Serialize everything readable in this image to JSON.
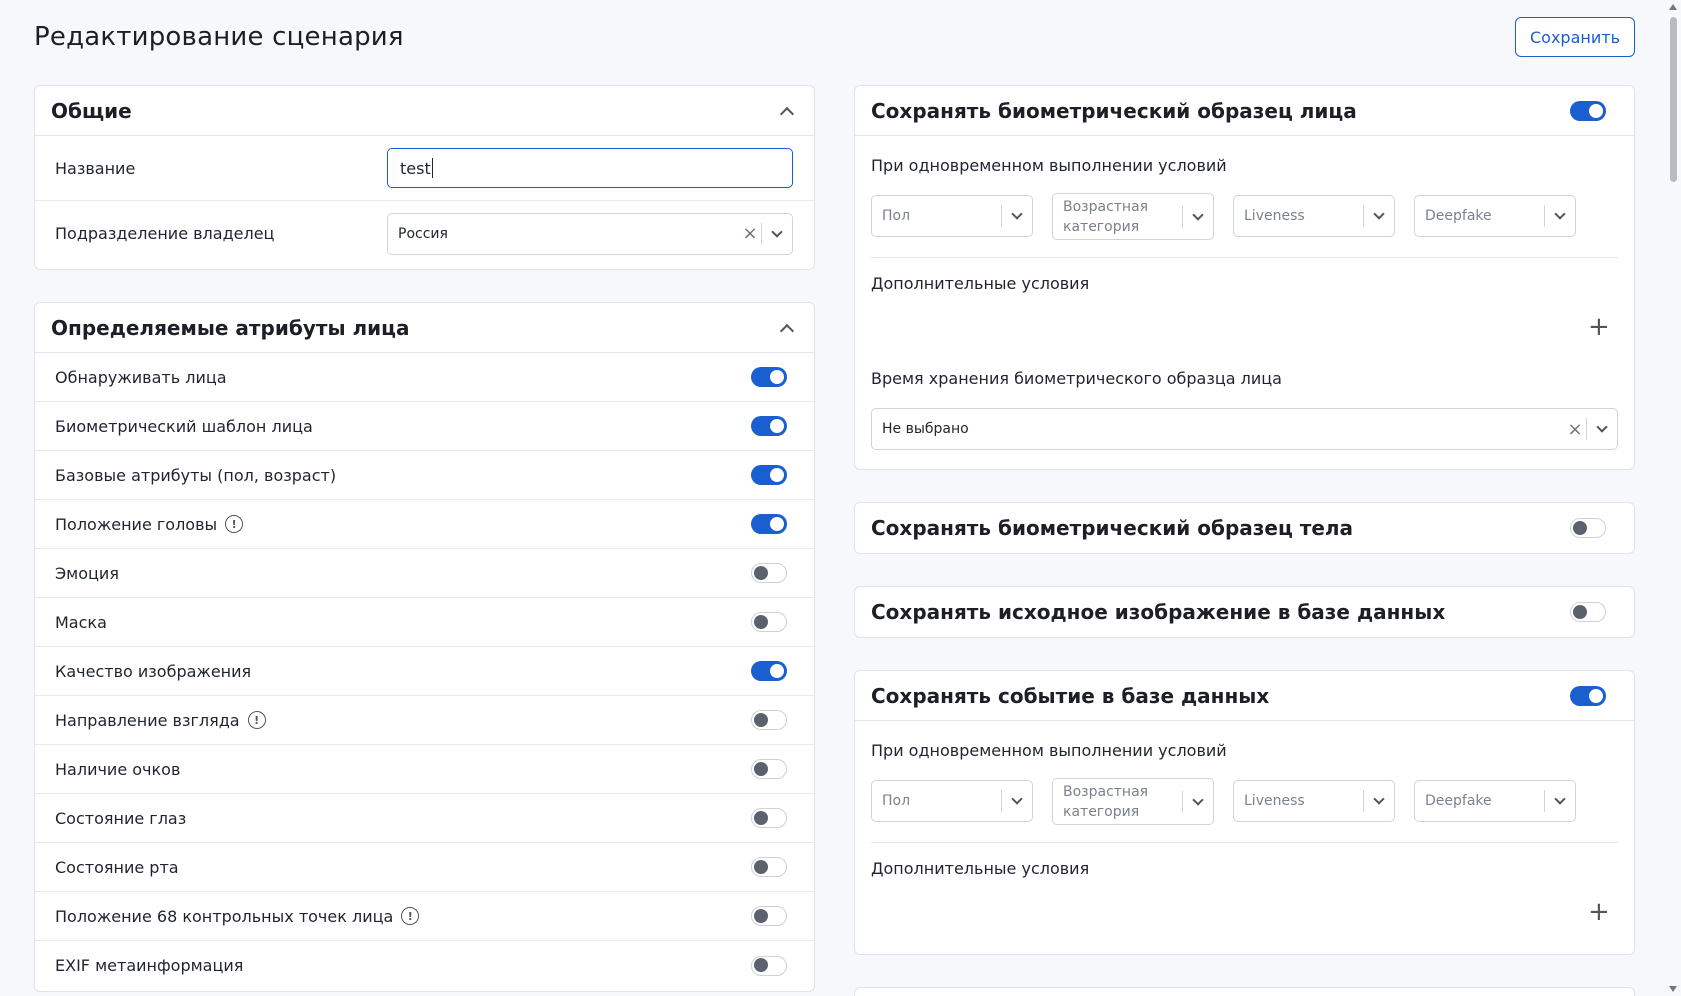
{
  "page": {
    "title": "Редактирование сценария",
    "save_label": "Сохранить"
  },
  "general": {
    "title": "Общие",
    "name_label": "Название",
    "name_value": "test",
    "owner_label": "Подразделение владелец",
    "owner_value": "Россия"
  },
  "attributes": {
    "title": "Определяемые атрибуты лица",
    "items": [
      {
        "label": "Обнаруживать лица",
        "on": true,
        "info": false
      },
      {
        "label": "Биометрический шаблон лица",
        "on": true,
        "info": false
      },
      {
        "label": "Базовые атрибуты (пол, возраст)",
        "on": true,
        "info": false
      },
      {
        "label": "Положение головы",
        "on": true,
        "info": true
      },
      {
        "label": "Эмоция",
        "on": false,
        "info": false
      },
      {
        "label": "Маска",
        "on": false,
        "info": false
      },
      {
        "label": "Качество изображения",
        "on": true,
        "info": false
      },
      {
        "label": "Направление взгляда",
        "on": false,
        "info": true
      },
      {
        "label": "Наличие очков",
        "on": false,
        "info": false
      },
      {
        "label": "Состояние глаз",
        "on": false,
        "info": false
      },
      {
        "label": "Состояние рта",
        "on": false,
        "info": false
      },
      {
        "label": "Положение 68 контрольных точек лица",
        "on": false,
        "info": true
      },
      {
        "label": "EXIF метаинформация",
        "on": false,
        "info": false
      }
    ]
  },
  "face_sample": {
    "title": "Сохранять биометрический образец лица",
    "on": true,
    "conditions_label": "При одновременном выполнении условий",
    "filters": [
      "Пол",
      "Возрастная категория",
      "Liveness",
      "Deepfake"
    ],
    "extra_label": "Дополнительные условия",
    "storage_label": "Время хранения биометрического образца лица",
    "storage_value": "Не выбрано"
  },
  "body_sample": {
    "title": "Сохранять биометрический образец тела",
    "on": false
  },
  "source_image": {
    "title": "Сохранять исходное изображение в базе данных",
    "on": false
  },
  "event": {
    "title": "Сохранять событие в базе данных",
    "on": true,
    "conditions_label": "При одновременном выполнении условий",
    "filters": [
      "Пол",
      "Возрастная категория",
      "Liveness",
      "Deepfake"
    ],
    "extra_label": "Дополнительные условия"
  },
  "icons": {
    "plus": "+",
    "clear": "×",
    "info": "!"
  },
  "colors": {
    "accent": "#1a5fd0",
    "toggle_off_knob": "#5c626d",
    "border": "#dfe3ea",
    "background": "#f6f8fb"
  }
}
